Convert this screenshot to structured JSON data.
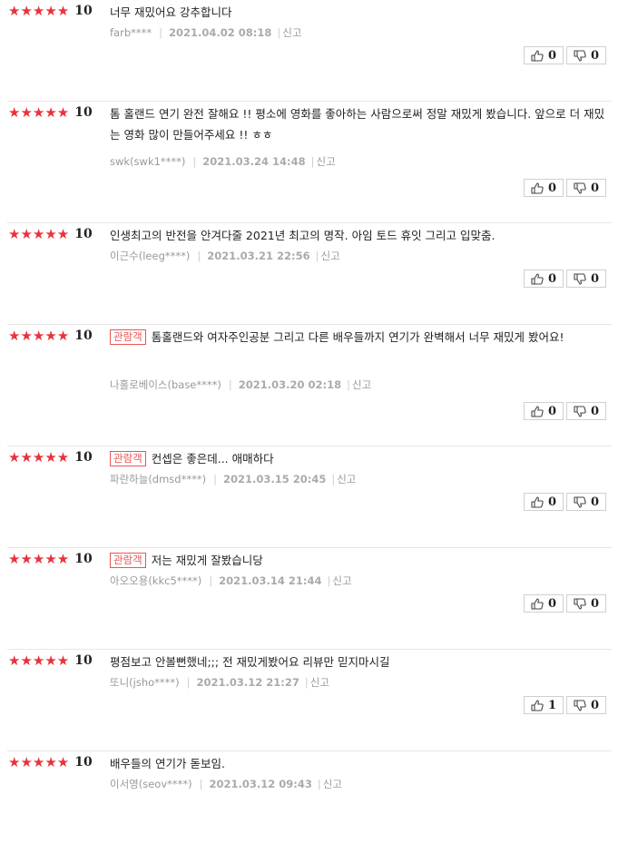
{
  "reviews": [
    {
      "stars": "★★★★★",
      "score": "10",
      "badge": "",
      "text": "너무 재밌어요 강추합니다",
      "user": "farb****",
      "date": "2021.04.02 08:18",
      "report": "신고",
      "likes": "0",
      "dislikes": "0"
    },
    {
      "stars": "★★★★★",
      "score": "10",
      "badge": "",
      "text": "톰 홀랜드 연기 완전 잘해요 !! 평소에 영화를 좋아하는 사람으로써 정말 재밌게 봤습니다. 앞으로 더 재밌는 영화 많이 만들어주세요 !! ㅎㅎ",
      "user": "swk(swk1****)",
      "date": "2021.03.24 14:48",
      "report": "신고",
      "likes": "0",
      "dislikes": "0"
    },
    {
      "stars": "★★★★★",
      "score": "10",
      "badge": "",
      "text": "인생최고의 반전을 안겨다줄 2021년 최고의 명작. 아임 토드 휴잇 그리고 입맞춤.",
      "user": "이근수(leeg****)",
      "date": "2021.03.21 22:56",
      "report": "신고",
      "likes": "0",
      "dislikes": "0"
    },
    {
      "stars": "★★★★★",
      "score": "10",
      "badge": "관람객",
      "text": "톰홀랜드와 여자주인공분 그리고 다른 배우들까지 연기가 완벽해서 너무 재밌게 봤어요!",
      "user": "나홀로베이스(base****)",
      "date": "2021.03.20 02:18",
      "report": "신고",
      "likes": "0",
      "dislikes": "0"
    },
    {
      "stars": "★★★★★",
      "score": "10",
      "badge": "관람객",
      "text": "컨셉은 좋은데... 애매하다",
      "user": "파란하늘(dmsd****)",
      "date": "2021.03.15 20:45",
      "report": "신고",
      "likes": "0",
      "dislikes": "0"
    },
    {
      "stars": "★★★★★",
      "score": "10",
      "badge": "관람객",
      "text": "저는 재밌게 잘봤습니당",
      "user": "아오오용(kkc5****)",
      "date": "2021.03.14 21:44",
      "report": "신고",
      "likes": "0",
      "dislikes": "0"
    },
    {
      "stars": "★★★★★",
      "score": "10",
      "badge": "",
      "text": "평점보고 안볼뻔했네;;; 전 재밌게봤어요 리뷰만 믿지마시길",
      "user": "또니(jsho****)",
      "date": "2021.03.12 21:27",
      "report": "신고",
      "likes": "1",
      "dislikes": "0"
    },
    {
      "stars": "★★★★★",
      "score": "10",
      "badge": "",
      "text": "배우들의 연기가 돋보임.",
      "user": "이서영(seov****)",
      "date": "2021.03.12 09:43",
      "report": "신고",
      "likes": "",
      "dislikes": ""
    }
  ],
  "icons": {
    "like": "thumbs-up-icon",
    "dislike": "thumbs-down-icon"
  },
  "colors": {
    "star": "#e8323c",
    "badge": "#e85656",
    "meta": "#999999"
  }
}
